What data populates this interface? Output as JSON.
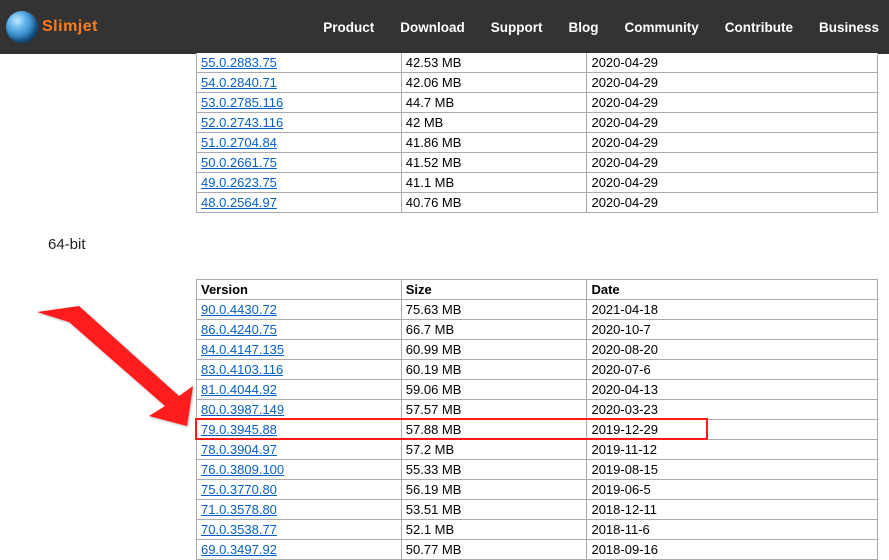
{
  "brand": "Slimjet",
  "nav": [
    "Product",
    "Download",
    "Support",
    "Blog",
    "Community",
    "Contribute",
    "Business"
  ],
  "section_label_64": "64-bit",
  "cols": {
    "version": "Version",
    "size": "Size",
    "date": "Date"
  },
  "table32_rows": [
    {
      "v": "55.0.2883.75",
      "s": "42.53 MB",
      "d": "2020-04-29"
    },
    {
      "v": "54.0.2840.71",
      "s": "42.06 MB",
      "d": "2020-04-29"
    },
    {
      "v": "53.0.2785.116",
      "s": "44.7 MB",
      "d": "2020-04-29"
    },
    {
      "v": "52.0.2743.116",
      "s": "42 MB",
      "d": "2020-04-29"
    },
    {
      "v": "51.0.2704.84",
      "s": "41.86 MB",
      "d": "2020-04-29"
    },
    {
      "v": "50.0.2661.75",
      "s": "41.52 MB",
      "d": "2020-04-29"
    },
    {
      "v": "49.0.2623.75",
      "s": "41.1 MB",
      "d": "2020-04-29"
    },
    {
      "v": "48.0.2564.97",
      "s": "40.76 MB",
      "d": "2020-04-29"
    }
  ],
  "table64_rows": [
    {
      "v": "90.0.4430.72",
      "s": "75.63 MB",
      "d": "2021-04-18"
    },
    {
      "v": "86.0.4240.75",
      "s": "66.7 MB",
      "d": "2020-10-7"
    },
    {
      "v": "84.0.4147.135",
      "s": "60.99 MB",
      "d": "2020-08-20"
    },
    {
      "v": "83.0.4103.116",
      "s": "60.19 MB",
      "d": "2020-07-6"
    },
    {
      "v": "81.0.4044.92",
      "s": "59.06 MB",
      "d": "2020-04-13"
    },
    {
      "v": "80.0.3987.149",
      "s": "57.57 MB",
      "d": "2020-03-23"
    },
    {
      "v": "79.0.3945.88",
      "s": "57.88 MB",
      "d": "2019-12-29",
      "highlight": true
    },
    {
      "v": "78.0.3904.97",
      "s": "57.2 MB",
      "d": "2019-11-12"
    },
    {
      "v": "76.0.3809.100",
      "s": "55.33 MB",
      "d": "2019-08-15"
    },
    {
      "v": "75.0.3770.80",
      "s": "56.19 MB",
      "d": "2019-06-5"
    },
    {
      "v": "71.0.3578.80",
      "s": "53.51 MB",
      "d": "2018-12-11"
    },
    {
      "v": "70.0.3538.77",
      "s": "52.1 MB",
      "d": "2018-11-6"
    },
    {
      "v": "69.0.3497.92",
      "s": "50.77 MB",
      "d": "2018-09-16"
    }
  ]
}
